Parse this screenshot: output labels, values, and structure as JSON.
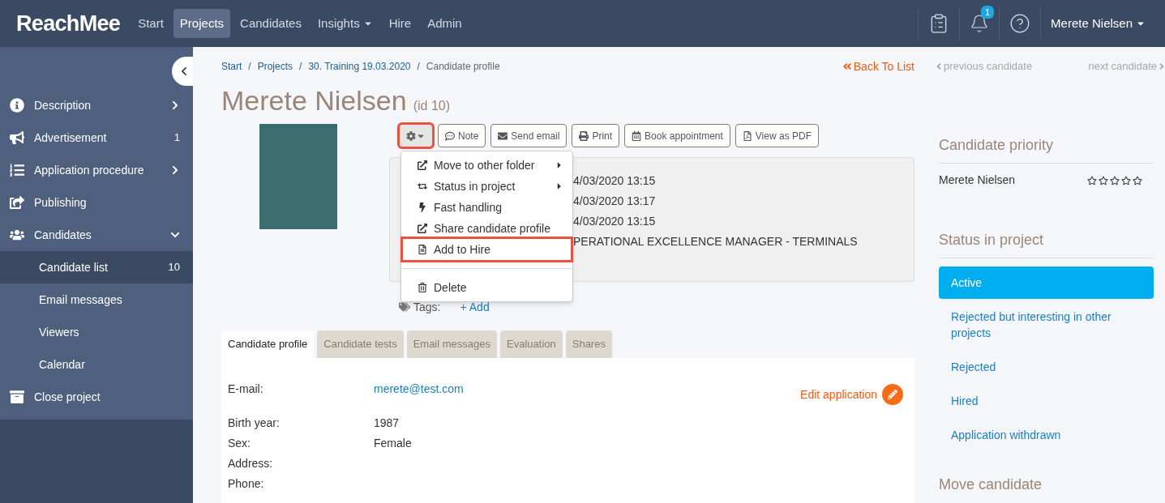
{
  "brand": "ReachMee",
  "nav": [
    {
      "label": "Start",
      "selected": false,
      "menu": false
    },
    {
      "label": "Projects",
      "selected": true,
      "menu": false
    },
    {
      "label": "Candidates",
      "selected": false,
      "menu": false
    },
    {
      "label": "Insights",
      "selected": false,
      "menu": true
    },
    {
      "label": "Hire",
      "selected": false,
      "menu": false
    },
    {
      "label": "Admin",
      "selected": false,
      "menu": false
    }
  ],
  "notifications": "1",
  "user": "Merete Nielsen",
  "sidebar": {
    "items": [
      {
        "label": "Description",
        "expanded": false,
        "selected": false
      },
      {
        "label": "Advertisement",
        "count": "1",
        "selected": false
      },
      {
        "label": "Application procedure",
        "expanded": false,
        "selected": false
      },
      {
        "label": "Publishing",
        "selected": false
      },
      {
        "label": "Candidates",
        "expanded": true,
        "selected": false,
        "children": [
          {
            "label": "Candidate list",
            "count": "10",
            "selected": true
          },
          {
            "label": "Email messages",
            "selected": false
          },
          {
            "label": "Viewers",
            "selected": false
          },
          {
            "label": "Calendar",
            "selected": false
          }
        ]
      },
      {
        "label": "Close project",
        "selected": false
      }
    ]
  },
  "breadcrumb": [
    {
      "label": "Start",
      "kind": "link"
    },
    {
      "label": "/",
      "kind": "separator"
    },
    {
      "label": "Projects",
      "kind": "link"
    },
    {
      "label": "/",
      "kind": "separator"
    },
    {
      "label": "30. Training 19.03.2020",
      "kind": "link"
    },
    {
      "label": "/",
      "kind": "separator"
    },
    {
      "label": "Candidate profile",
      "kind": "current"
    }
  ],
  "back_link": "Back To List",
  "previous_candidate": "previous candidate",
  "next_candidate": "next candidate",
  "title": "Merete Nielsen",
  "id_label": "(id 10)",
  "actions": {
    "gear_highlighted": true,
    "buttons": [
      "Note",
      "Send email",
      "Print",
      "Book appointment",
      "View as PDF"
    ]
  },
  "menu": [
    {
      "label": "Move to other folder",
      "submenu": true,
      "highlighted": false
    },
    {
      "label": "Status in project",
      "submenu": true,
      "highlighted": false
    },
    {
      "label": "Fast handling",
      "highlighted": false
    },
    {
      "label": "Share candidate profile",
      "highlighted": false
    },
    {
      "label": "Add to Hire",
      "highlighted": true
    },
    {
      "label": "Delete",
      "highlighted": false,
      "separated": true
    }
  ],
  "info_lines": [
    "4/03/2020 13:15",
    "4/03/2020 13:17",
    "4/03/2020 13:15",
    "PERATIONAL EXCELLENCE MANAGER - TERMINALS"
  ],
  "tags": {
    "label": "Tags:",
    "add": "+ Add"
  },
  "tabs": [
    {
      "label": "Candidate profile",
      "selected": true
    },
    {
      "label": "Candidate tests",
      "selected": false
    },
    {
      "label": "Email messages",
      "selected": false
    },
    {
      "label": "Evaluation",
      "selected": false
    },
    {
      "label": "Shares",
      "selected": false
    }
  ],
  "edit_application": "Edit application",
  "fields": [
    {
      "label": "E-mail:",
      "value": "merete@test.com",
      "kind": "link"
    },
    {
      "label": "Birth year:",
      "value": "1987",
      "kind": "text"
    },
    {
      "label": "Sex:",
      "value": "Female",
      "kind": "text"
    },
    {
      "label": "Address:"
    },
    {
      "label": "Phone:"
    }
  ],
  "priority": {
    "title": "Candidate priority",
    "name": "Merete Nielsen",
    "stars": 0
  },
  "status": {
    "title": "Status in project",
    "options": [
      {
        "label": "Active",
        "selected": true
      },
      {
        "label": "Rejected but interesting in other projects",
        "selected": false
      },
      {
        "label": "Rejected",
        "selected": false
      },
      {
        "label": "Hired",
        "selected": false
      },
      {
        "label": "Application withdrawn",
        "selected": false
      }
    ]
  },
  "move_title": "Move candidate"
}
